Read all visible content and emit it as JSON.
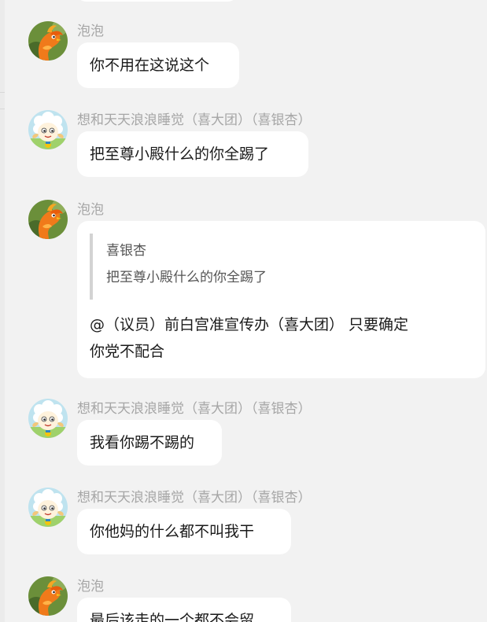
{
  "colors": {
    "background": "#f2f2f2",
    "bubble": "#ffffff",
    "sender_name": "#a6a6a6",
    "message_text": "#1a1a1a",
    "quote_text": "#555555",
    "quote_bar": "#d3d3d3"
  },
  "messages": [
    {
      "sender": "泡泡",
      "avatar_icon": "phoenix-avatar-icon",
      "text": "你不用在这说这个"
    },
    {
      "sender": "想和天天浪浪睡觉（喜大团）（喜银杏）",
      "avatar_icon": "sheep-avatar-icon",
      "text": "把至尊小殿什么的你全踢了"
    },
    {
      "sender": "泡泡",
      "avatar_icon": "phoenix-avatar-icon",
      "quote": {
        "author": "喜银杏",
        "text": "把至尊小殿什么的你全踢了"
      },
      "text_line1": "@（议员）前白宫准宣传办（喜大团） 只要确定",
      "text_line2": "你党不配合"
    },
    {
      "sender": "想和天天浪浪睡觉（喜大团）（喜银杏）",
      "avatar_icon": "sheep-avatar-icon",
      "text": "我看你踢不踢的"
    },
    {
      "sender": "想和天天浪浪睡觉（喜大团）（喜银杏）",
      "avatar_icon": "sheep-avatar-icon",
      "text": "你他妈的什么都不叫我干"
    },
    {
      "sender": "泡泡",
      "avatar_icon": "phoenix-avatar-icon",
      "text": "最后该走的一个都不会留"
    }
  ]
}
